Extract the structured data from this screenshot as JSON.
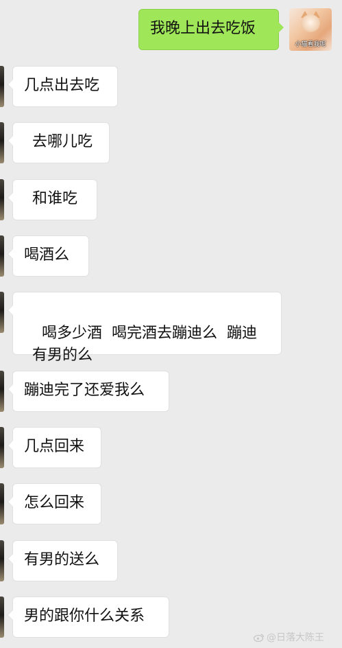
{
  "chat": {
    "self_message": {
      "text": "我晚上出去吃饭",
      "avatar_caption": "小猫看我呢"
    },
    "messages": [
      {
        "text": "几点出去吃"
      },
      {
        "text": "去哪儿吃"
      },
      {
        "text": "和谁吃"
      },
      {
        "text": "喝酒么"
      },
      {
        "text": "喝多少酒  喝完酒去蹦迪么  蹦迪有男的么"
      },
      {
        "text": "蹦迪完了还爱我么"
      },
      {
        "text": "几点回来"
      },
      {
        "text": "怎么回来"
      },
      {
        "text": "有男的送么"
      },
      {
        "text": "男的跟你什么关系"
      }
    ]
  },
  "watermark": {
    "text": "@日落大陈王",
    "icon": "weibo-icon"
  },
  "colors": {
    "background": "#ebebeb",
    "self_bubble": "#9fe658",
    "other_bubble": "#ffffff"
  }
}
